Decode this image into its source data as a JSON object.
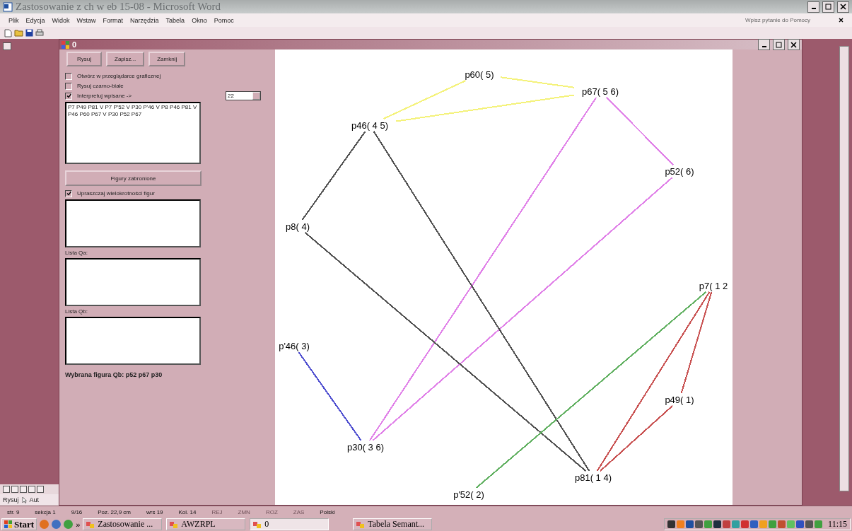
{
  "word": {
    "title": "Zastosowanie z ch w eb 15-08 - Microsoft Word",
    "menu": [
      "Plik",
      "Edycja",
      "Widok",
      "Wstaw",
      "Format",
      "Narzędzia",
      "Tabela",
      "Okno",
      "Pomoc"
    ],
    "help_field": {
      "placeholder": "Wpisz pytanie do Pomocy"
    },
    "draw_menu": "Rysuj",
    "autoshapes": "Aut"
  },
  "dialog": {
    "title": "0",
    "buttons": [
      "Rysuj",
      "Zapisz...",
      "Zamknij"
    ],
    "options": [
      {
        "label": "Otwórz w przeglądarce graficznej",
        "checked": false
      },
      {
        "label": "Rysuj czarno-białe",
        "checked": false
      },
      {
        "label": "Interpretuj wpisane ->",
        "checked": true
      }
    ],
    "combo_value": "22",
    "input_text": "P7 P49 P81 V P7 P'52 V P30 P'46 V P8 P46 P81 V P46 P60 P67 V P30 P52 P67",
    "forbidden_button": "Figury zabronione",
    "simplify": {
      "label": "Upraszczaj wielokrotności figur",
      "checked": true
    },
    "lists": [
      {
        "label": "Lista Qa:"
      },
      {
        "label": "Lista Qb:"
      }
    ],
    "selected_figure": "Wybrana figura Qb: p52 p67 p30"
  },
  "graph": {
    "nodes": [
      {
        "label": "p60( 5)"
      },
      {
        "label": "p67( 5 6)"
      },
      {
        "label": "p46( 4 5)"
      },
      {
        "label": "p52( 6)"
      },
      {
        "label": "p8( 4)"
      },
      {
        "label": "p7( 1 2"
      },
      {
        "label": "p'46( 3)"
      },
      {
        "label": "p49( 1)"
      },
      {
        "label": "p30( 3 6)"
      },
      {
        "label": "p81( 1 4)"
      },
      {
        "label": "p'52( 2)"
      }
    ],
    "figures": [
      {
        "color": "#f4f27a"
      },
      {
        "color": "#e080e8"
      },
      {
        "color": "#505050"
      },
      {
        "color": "#5050d0"
      },
      {
        "color": "#60b060"
      },
      {
        "color": "#c85050"
      }
    ]
  },
  "status_bar": [
    {
      "text": "str. 9",
      "disabled": false
    },
    {
      "text": "sekcja 1",
      "disabled": false
    },
    {
      "text": "9/16",
      "disabled": false
    },
    {
      "text": "Poz. 22,9 cm",
      "disabled": false
    },
    {
      "text": "wrs 19",
      "disabled": false
    },
    {
      "text": "Kol. 14",
      "disabled": false
    },
    {
      "text": "REJ",
      "disabled": true
    },
    {
      "text": "ZMN",
      "disabled": true
    },
    {
      "text": "ROZ",
      "disabled": true
    },
    {
      "text": "ZAS",
      "disabled": true
    },
    {
      "text": "Polski",
      "disabled": false
    }
  ],
  "taskbar": {
    "start": "Start",
    "more": "»",
    "tasks": [
      {
        "label": "Zastosowanie ...",
        "selected": false
      },
      {
        "label": "AWZRPL",
        "selected": false
      },
      {
        "label": "0",
        "selected": true
      },
      {
        "label": "Tabela Semant...",
        "selected": false
      }
    ],
    "clock": "11:15"
  }
}
